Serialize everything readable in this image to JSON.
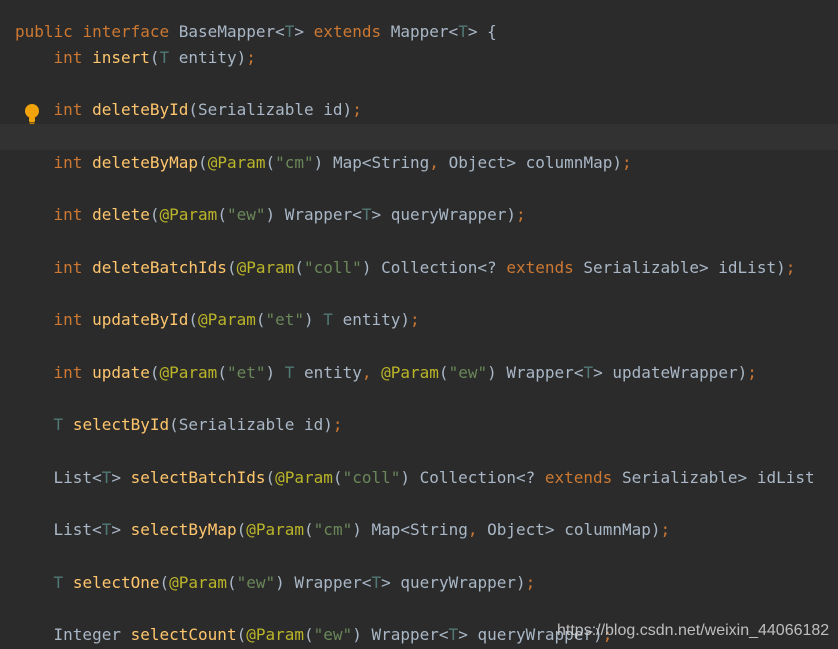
{
  "editor": {
    "lines": [
      {
        "indent": "",
        "tokens": [
          [
            "kw",
            "public"
          ],
          [
            "ws",
            " "
          ],
          [
            "kw",
            "interface"
          ],
          [
            "ws",
            " "
          ],
          [
            "type",
            "BaseMapper"
          ],
          [
            "punct",
            "<"
          ],
          [
            "tp",
            "T"
          ],
          [
            "punct",
            ">"
          ],
          [
            "ws",
            " "
          ],
          [
            "kw",
            "extends"
          ],
          [
            "ws",
            " "
          ],
          [
            "type",
            "Mapper"
          ],
          [
            "punct",
            "<"
          ],
          [
            "tp",
            "T"
          ],
          [
            "punct",
            "> {"
          ]
        ]
      },
      {
        "indent": "    ",
        "tokens": [
          [
            "kw",
            "int"
          ],
          [
            "ws",
            " "
          ],
          [
            "method",
            "insert"
          ],
          [
            "punct",
            "("
          ],
          [
            "tp",
            "T"
          ],
          [
            "ws",
            " "
          ],
          [
            "plain",
            "entity"
          ],
          [
            "punct",
            ")"
          ],
          [
            "semi",
            ";"
          ]
        ]
      },
      {
        "indent": "    ",
        "tokens": [
          [
            "kw",
            "int"
          ],
          [
            "ws",
            " "
          ],
          [
            "method",
            "deleteById"
          ],
          [
            "punct",
            "("
          ],
          [
            "type",
            "Serializable"
          ],
          [
            "ws",
            " "
          ],
          [
            "plain",
            "id"
          ],
          [
            "punct",
            ")"
          ],
          [
            "semi",
            ";"
          ]
        ]
      },
      {
        "indent": "    ",
        "tokens": [
          [
            "kw",
            "int"
          ],
          [
            "ws",
            " "
          ],
          [
            "method",
            "deleteByMap"
          ],
          [
            "punct",
            "("
          ],
          [
            "ann",
            "@Param"
          ],
          [
            "punct",
            "("
          ],
          [
            "str",
            "\"cm\""
          ],
          [
            "punct",
            ")"
          ],
          [
            "ws",
            " "
          ],
          [
            "type",
            "Map"
          ],
          [
            "punct",
            "<"
          ],
          [
            "type",
            "String"
          ],
          [
            "semi",
            ","
          ],
          [
            "ws",
            " "
          ],
          [
            "type",
            "Object"
          ],
          [
            "punct",
            ">"
          ],
          [
            "ws",
            " "
          ],
          [
            "plain",
            "columnMap"
          ],
          [
            "punct",
            ")"
          ],
          [
            "semi",
            ";"
          ]
        ]
      },
      {
        "indent": "    ",
        "tokens": [
          [
            "kw",
            "int"
          ],
          [
            "ws",
            " "
          ],
          [
            "method",
            "delete"
          ],
          [
            "punct",
            "("
          ],
          [
            "ann",
            "@Param"
          ],
          [
            "punct",
            "("
          ],
          [
            "str",
            "\"ew\""
          ],
          [
            "punct",
            ")"
          ],
          [
            "ws",
            " "
          ],
          [
            "type",
            "Wrapper"
          ],
          [
            "punct",
            "<"
          ],
          [
            "tp",
            "T"
          ],
          [
            "punct",
            ">"
          ],
          [
            "ws",
            " "
          ],
          [
            "plain",
            "queryWrapper"
          ],
          [
            "punct",
            ")"
          ],
          [
            "semi",
            ";"
          ]
        ]
      },
      {
        "indent": "    ",
        "tokens": [
          [
            "kw",
            "int"
          ],
          [
            "ws",
            " "
          ],
          [
            "method",
            "deleteBatchIds"
          ],
          [
            "punct",
            "("
          ],
          [
            "ann",
            "@Param"
          ],
          [
            "punct",
            "("
          ],
          [
            "str",
            "\"coll\""
          ],
          [
            "punct",
            ")"
          ],
          [
            "ws",
            " "
          ],
          [
            "type",
            "Collection"
          ],
          [
            "punct",
            "<? "
          ],
          [
            "kw",
            "extends"
          ],
          [
            "ws",
            " "
          ],
          [
            "type",
            "Serializable"
          ],
          [
            "punct",
            ">"
          ],
          [
            "ws",
            " "
          ],
          [
            "plain",
            "idList"
          ],
          [
            "punct",
            ")"
          ],
          [
            "semi",
            ";"
          ]
        ]
      },
      {
        "indent": "    ",
        "tokens": [
          [
            "kw",
            "int"
          ],
          [
            "ws",
            " "
          ],
          [
            "method",
            "updateById"
          ],
          [
            "punct",
            "("
          ],
          [
            "ann",
            "@Param"
          ],
          [
            "punct",
            "("
          ],
          [
            "str",
            "\"et\""
          ],
          [
            "punct",
            ")"
          ],
          [
            "ws",
            " "
          ],
          [
            "tp",
            "T"
          ],
          [
            "ws",
            " "
          ],
          [
            "plain",
            "entity"
          ],
          [
            "punct",
            ")"
          ],
          [
            "semi",
            ";"
          ]
        ]
      },
      {
        "indent": "    ",
        "tokens": [
          [
            "kw",
            "int"
          ],
          [
            "ws",
            " "
          ],
          [
            "method",
            "update"
          ],
          [
            "punct",
            "("
          ],
          [
            "ann",
            "@Param"
          ],
          [
            "punct",
            "("
          ],
          [
            "str",
            "\"et\""
          ],
          [
            "punct",
            ")"
          ],
          [
            "ws",
            " "
          ],
          [
            "tp",
            "T"
          ],
          [
            "ws",
            " "
          ],
          [
            "plain",
            "entity"
          ],
          [
            "semi",
            ","
          ],
          [
            "ws",
            " "
          ],
          [
            "ann",
            "@Param"
          ],
          [
            "punct",
            "("
          ],
          [
            "str",
            "\"ew\""
          ],
          [
            "punct",
            ")"
          ],
          [
            "ws",
            " "
          ],
          [
            "type",
            "Wrapper"
          ],
          [
            "punct",
            "<"
          ],
          [
            "tp",
            "T"
          ],
          [
            "punct",
            ">"
          ],
          [
            "ws",
            " "
          ],
          [
            "plain",
            "updateWrapper"
          ],
          [
            "punct",
            ")"
          ],
          [
            "semi",
            ";"
          ]
        ]
      },
      {
        "indent": "    ",
        "tokens": [
          [
            "tp",
            "T"
          ],
          [
            "ws",
            " "
          ],
          [
            "method",
            "selectById"
          ],
          [
            "punct",
            "("
          ],
          [
            "type",
            "Serializable"
          ],
          [
            "ws",
            " "
          ],
          [
            "plain",
            "id"
          ],
          [
            "punct",
            ")"
          ],
          [
            "semi",
            ";"
          ]
        ]
      },
      {
        "indent": "    ",
        "tokens": [
          [
            "type",
            "List"
          ],
          [
            "punct",
            "<"
          ],
          [
            "tp",
            "T"
          ],
          [
            "punct",
            ">"
          ],
          [
            "ws",
            " "
          ],
          [
            "method",
            "selectBatchIds"
          ],
          [
            "punct",
            "("
          ],
          [
            "ann",
            "@Param"
          ],
          [
            "punct",
            "("
          ],
          [
            "str",
            "\"coll\""
          ],
          [
            "punct",
            ")"
          ],
          [
            "ws",
            " "
          ],
          [
            "type",
            "Collection"
          ],
          [
            "punct",
            "<? "
          ],
          [
            "kw",
            "extends"
          ],
          [
            "ws",
            " "
          ],
          [
            "type",
            "Serializable"
          ],
          [
            "punct",
            ">"
          ],
          [
            "ws",
            " "
          ],
          [
            "plain",
            "idList"
          ]
        ]
      },
      {
        "indent": "    ",
        "tokens": [
          [
            "type",
            "List"
          ],
          [
            "punct",
            "<"
          ],
          [
            "tp",
            "T"
          ],
          [
            "punct",
            ">"
          ],
          [
            "ws",
            " "
          ],
          [
            "method",
            "selectByMap"
          ],
          [
            "punct",
            "("
          ],
          [
            "ann",
            "@Param"
          ],
          [
            "punct",
            "("
          ],
          [
            "str",
            "\"cm\""
          ],
          [
            "punct",
            ")"
          ],
          [
            "ws",
            " "
          ],
          [
            "type",
            "Map"
          ],
          [
            "punct",
            "<"
          ],
          [
            "type",
            "String"
          ],
          [
            "semi",
            ","
          ],
          [
            "ws",
            " "
          ],
          [
            "type",
            "Object"
          ],
          [
            "punct",
            ">"
          ],
          [
            "ws",
            " "
          ],
          [
            "plain",
            "columnMap"
          ],
          [
            "punct",
            ")"
          ],
          [
            "semi",
            ";"
          ]
        ]
      },
      {
        "indent": "    ",
        "tokens": [
          [
            "tp",
            "T"
          ],
          [
            "ws",
            " "
          ],
          [
            "method",
            "selectOne"
          ],
          [
            "punct",
            "("
          ],
          [
            "ann",
            "@Param"
          ],
          [
            "punct",
            "("
          ],
          [
            "str",
            "\"ew\""
          ],
          [
            "punct",
            ")"
          ],
          [
            "ws",
            " "
          ],
          [
            "type",
            "Wrapper"
          ],
          [
            "punct",
            "<"
          ],
          [
            "tp",
            "T"
          ],
          [
            "punct",
            ">"
          ],
          [
            "ws",
            " "
          ],
          [
            "plain",
            "queryWrapper"
          ],
          [
            "punct",
            ")"
          ],
          [
            "semi",
            ";"
          ]
        ]
      },
      {
        "indent": "    ",
        "tokens": [
          [
            "type",
            "Integer"
          ],
          [
            "ws",
            " "
          ],
          [
            "method",
            "selectCount"
          ],
          [
            "punct",
            "("
          ],
          [
            "ann",
            "@Param"
          ],
          [
            "punct",
            "("
          ],
          [
            "str",
            "\"ew\""
          ],
          [
            "punct",
            ")"
          ],
          [
            "ws",
            " "
          ],
          [
            "type",
            "Wrapper"
          ],
          [
            "punct",
            "<"
          ],
          [
            "tp",
            "T"
          ],
          [
            "punct",
            ">"
          ],
          [
            "ws",
            " "
          ],
          [
            "plain",
            "queryWrapper"
          ],
          [
            "punct",
            ")"
          ],
          [
            "semi",
            ";"
          ]
        ]
      }
    ],
    "gutter_icon": "lightbulb-icon"
  },
  "watermark": {
    "text": "https://blog.csdn.net/weixin_44066182"
  },
  "colors": {
    "background": "#2b2b2b",
    "keyword": "#cc7832",
    "method": "#ffc66d",
    "annotation": "#bbb529",
    "string": "#6a8759",
    "type_param": "#507874",
    "text": "#a9b7c6",
    "caret_line": "#323232"
  }
}
